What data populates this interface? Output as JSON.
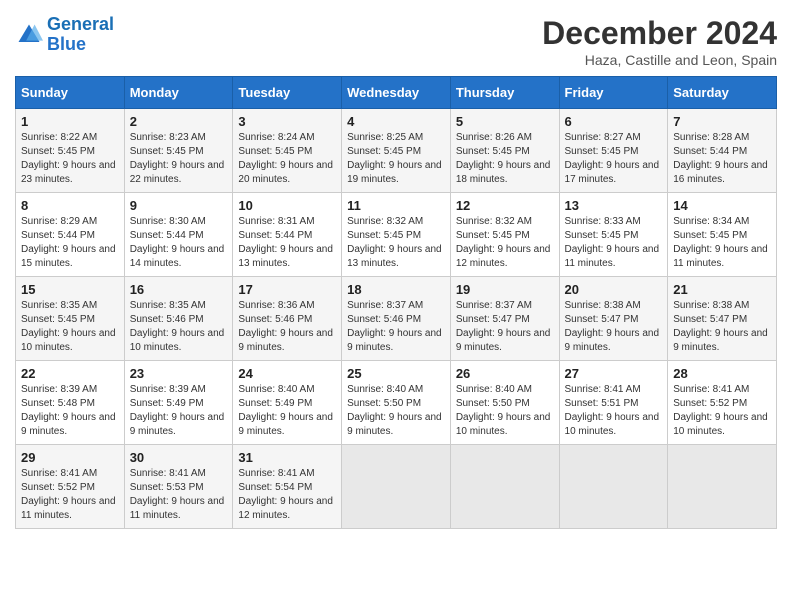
{
  "logo": {
    "line1": "General",
    "line2": "Blue"
  },
  "title": "December 2024",
  "location": "Haza, Castille and Leon, Spain",
  "days_of_week": [
    "Sunday",
    "Monday",
    "Tuesday",
    "Wednesday",
    "Thursday",
    "Friday",
    "Saturday"
  ],
  "weeks": [
    [
      {
        "day": "1",
        "info": "Sunrise: 8:22 AM\nSunset: 5:45 PM\nDaylight: 9 hours and 23 minutes."
      },
      {
        "day": "2",
        "info": "Sunrise: 8:23 AM\nSunset: 5:45 PM\nDaylight: 9 hours and 22 minutes."
      },
      {
        "day": "3",
        "info": "Sunrise: 8:24 AM\nSunset: 5:45 PM\nDaylight: 9 hours and 20 minutes."
      },
      {
        "day": "4",
        "info": "Sunrise: 8:25 AM\nSunset: 5:45 PM\nDaylight: 9 hours and 19 minutes."
      },
      {
        "day": "5",
        "info": "Sunrise: 8:26 AM\nSunset: 5:45 PM\nDaylight: 9 hours and 18 minutes."
      },
      {
        "day": "6",
        "info": "Sunrise: 8:27 AM\nSunset: 5:45 PM\nDaylight: 9 hours and 17 minutes."
      },
      {
        "day": "7",
        "info": "Sunrise: 8:28 AM\nSunset: 5:44 PM\nDaylight: 9 hours and 16 minutes."
      }
    ],
    [
      {
        "day": "8",
        "info": "Sunrise: 8:29 AM\nSunset: 5:44 PM\nDaylight: 9 hours and 15 minutes."
      },
      {
        "day": "9",
        "info": "Sunrise: 8:30 AM\nSunset: 5:44 PM\nDaylight: 9 hours and 14 minutes."
      },
      {
        "day": "10",
        "info": "Sunrise: 8:31 AM\nSunset: 5:44 PM\nDaylight: 9 hours and 13 minutes."
      },
      {
        "day": "11",
        "info": "Sunrise: 8:32 AM\nSunset: 5:45 PM\nDaylight: 9 hours and 13 minutes."
      },
      {
        "day": "12",
        "info": "Sunrise: 8:32 AM\nSunset: 5:45 PM\nDaylight: 9 hours and 12 minutes."
      },
      {
        "day": "13",
        "info": "Sunrise: 8:33 AM\nSunset: 5:45 PM\nDaylight: 9 hours and 11 minutes."
      },
      {
        "day": "14",
        "info": "Sunrise: 8:34 AM\nSunset: 5:45 PM\nDaylight: 9 hours and 11 minutes."
      }
    ],
    [
      {
        "day": "15",
        "info": "Sunrise: 8:35 AM\nSunset: 5:45 PM\nDaylight: 9 hours and 10 minutes."
      },
      {
        "day": "16",
        "info": "Sunrise: 8:35 AM\nSunset: 5:46 PM\nDaylight: 9 hours and 10 minutes."
      },
      {
        "day": "17",
        "info": "Sunrise: 8:36 AM\nSunset: 5:46 PM\nDaylight: 9 hours and 9 minutes."
      },
      {
        "day": "18",
        "info": "Sunrise: 8:37 AM\nSunset: 5:46 PM\nDaylight: 9 hours and 9 minutes."
      },
      {
        "day": "19",
        "info": "Sunrise: 8:37 AM\nSunset: 5:47 PM\nDaylight: 9 hours and 9 minutes."
      },
      {
        "day": "20",
        "info": "Sunrise: 8:38 AM\nSunset: 5:47 PM\nDaylight: 9 hours and 9 minutes."
      },
      {
        "day": "21",
        "info": "Sunrise: 8:38 AM\nSunset: 5:47 PM\nDaylight: 9 hours and 9 minutes."
      }
    ],
    [
      {
        "day": "22",
        "info": "Sunrise: 8:39 AM\nSunset: 5:48 PM\nDaylight: 9 hours and 9 minutes."
      },
      {
        "day": "23",
        "info": "Sunrise: 8:39 AM\nSunset: 5:49 PM\nDaylight: 9 hours and 9 minutes."
      },
      {
        "day": "24",
        "info": "Sunrise: 8:40 AM\nSunset: 5:49 PM\nDaylight: 9 hours and 9 minutes."
      },
      {
        "day": "25",
        "info": "Sunrise: 8:40 AM\nSunset: 5:50 PM\nDaylight: 9 hours and 9 minutes."
      },
      {
        "day": "26",
        "info": "Sunrise: 8:40 AM\nSunset: 5:50 PM\nDaylight: 9 hours and 10 minutes."
      },
      {
        "day": "27",
        "info": "Sunrise: 8:41 AM\nSunset: 5:51 PM\nDaylight: 9 hours and 10 minutes."
      },
      {
        "day": "28",
        "info": "Sunrise: 8:41 AM\nSunset: 5:52 PM\nDaylight: 9 hours and 10 minutes."
      }
    ],
    [
      {
        "day": "29",
        "info": "Sunrise: 8:41 AM\nSunset: 5:52 PM\nDaylight: 9 hours and 11 minutes."
      },
      {
        "day": "30",
        "info": "Sunrise: 8:41 AM\nSunset: 5:53 PM\nDaylight: 9 hours and 11 minutes."
      },
      {
        "day": "31",
        "info": "Sunrise: 8:41 AM\nSunset: 5:54 PM\nDaylight: 9 hours and 12 minutes."
      },
      {
        "day": "",
        "info": ""
      },
      {
        "day": "",
        "info": ""
      },
      {
        "day": "",
        "info": ""
      },
      {
        "day": "",
        "info": ""
      }
    ]
  ]
}
